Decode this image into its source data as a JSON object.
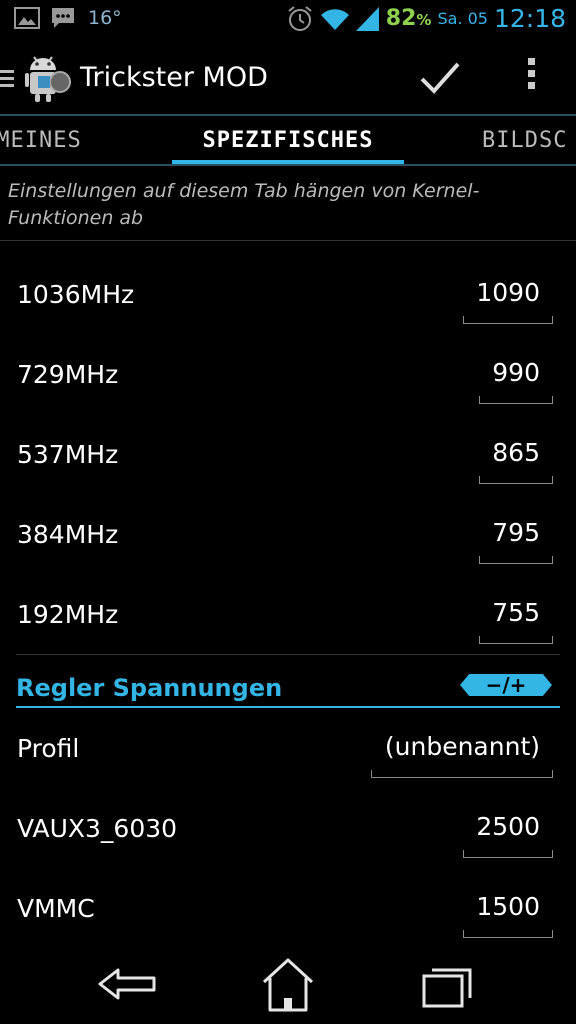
{
  "status_bar": {
    "temperature": "16°",
    "battery": "82",
    "battery_unit": "%",
    "date": "Sa. 05",
    "time": "12:18"
  },
  "action_bar": {
    "title": "Trickster MOD"
  },
  "tabs": [
    {
      "label": "EMEINES"
    },
    {
      "label": "SPEZIFISCHES"
    },
    {
      "label": "BILDSC"
    }
  ],
  "description": "Einstellungen auf diesem Tab hängen von Kernel-Funktionen ab",
  "freq_rows": [
    {
      "label": "1036MHz",
      "value": "1090"
    },
    {
      "label": "729MHz",
      "value": "990"
    },
    {
      "label": "537MHz",
      "value": "865"
    },
    {
      "label": "384MHz",
      "value": "795"
    },
    {
      "label": "192MHz",
      "value": "755"
    }
  ],
  "section": {
    "title": "Regler Spannungen",
    "toggle": "−/+"
  },
  "regulator_rows": [
    {
      "label": "Profil",
      "value": "(unbenannt)"
    },
    {
      "label": "VAUX3_6030",
      "value": "2500"
    },
    {
      "label": "VMMC",
      "value": "1500"
    }
  ],
  "colors": {
    "accent": "#33b5e5",
    "battery": "#8fd14f",
    "background": "#000000"
  }
}
